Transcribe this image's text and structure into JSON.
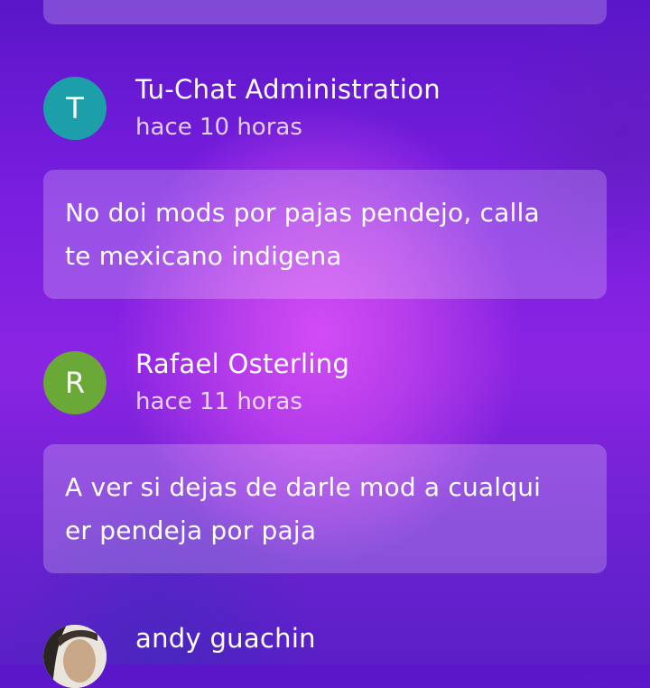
{
  "comments": [
    {
      "author": "Tu-Chat Administration",
      "avatar_letter": "T",
      "avatar_color": "#1d9fa9",
      "time": "hace 10 horas",
      "text": "No doi mods por pajas pendejo, calla\nte mexicano indigena"
    },
    {
      "author": "Rafael Osterling",
      "avatar_letter": "R",
      "avatar_color": "#6aa838",
      "time": "hace 11 horas",
      "text": "A ver si dejas de darle mod a cualqui\ner pendeja por paja"
    },
    {
      "author": "andy guachin",
      "avatar_icon": "user-photo-avatar"
    }
  ]
}
